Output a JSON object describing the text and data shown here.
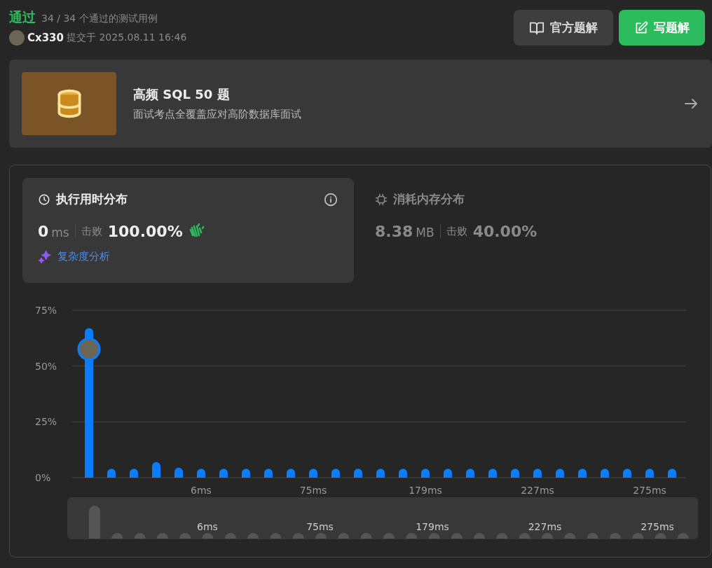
{
  "result": {
    "status": "通过",
    "count": "34 / 34",
    "count_label": "个通过的测试用例",
    "user": "Cx330",
    "submitted_label": "提交于",
    "submitted_time": "2025.08.11 16:46"
  },
  "buttons": [
    {
      "label": "官方题解",
      "kind": "secondary"
    },
    {
      "label": "写题解",
      "kind": "primary"
    }
  ],
  "study_plan": {
    "title": "高频 SQL 50 题",
    "subtitle": "面试考点全覆盖应对高阶数据库面试"
  },
  "metrics": [
    {
      "title": "执行用时分布",
      "value": "0",
      "unit": "ms",
      "beats_label": "击败",
      "beats": "100.00%",
      "selected": true,
      "link": "复杂度分析"
    },
    {
      "title": "消耗内存分布",
      "value": "8.38",
      "unit": "MB",
      "beats_label": "击败",
      "beats": "40.00%",
      "selected": false
    }
  ],
  "chart_data": {
    "type": "bar",
    "values": [
      67,
      4,
      4,
      7,
      4.5,
      4,
      4,
      4,
      4,
      4,
      4,
      4,
      4,
      4,
      4,
      4,
      4,
      4,
      4,
      4,
      4,
      4,
      4,
      4,
      4,
      4,
      4
    ],
    "ylim": [
      0,
      75
    ],
    "yticks": [
      {
        "value": 0,
        "label": "0%"
      },
      {
        "value": 25,
        "label": "25%"
      },
      {
        "value": 50,
        "label": "50%"
      },
      {
        "value": 75,
        "label": "75%"
      }
    ],
    "orientation": "vertical"
  },
  "x_axis_labels": [
    "6ms",
    "75ms",
    "179ms",
    "227ms",
    "275ms"
  ],
  "navigator": {
    "labels": [
      "6ms",
      "75ms",
      "179ms",
      "227ms",
      "275ms"
    ]
  }
}
